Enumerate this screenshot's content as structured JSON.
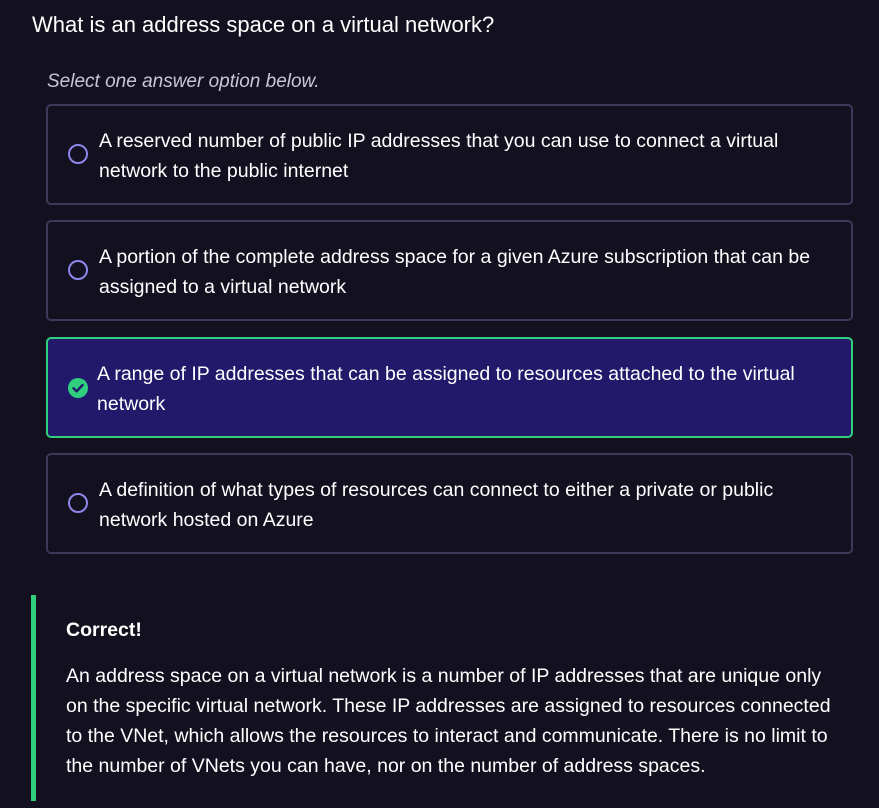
{
  "question": "What is an address space on a virtual network?",
  "instruction": "Select one answer option below.",
  "options": [
    {
      "text": "A reserved number of public IP addresses that you can use to connect a virtual network to the public internet",
      "selected": false
    },
    {
      "text": "A portion of the complete address space for a given Azure subscription that can be assigned to a virtual network",
      "selected": false
    },
    {
      "text": "A range of IP addresses that can be assigned to resources attached to the virtual network",
      "selected": true
    },
    {
      "text": "A definition of what types of resources can connect to either a private or public network hosted on Azure",
      "selected": false
    }
  ],
  "feedback": {
    "title": "Correct!",
    "body": "An address space on a virtual network is a number of IP addresses that are unique only on the specific virtual network. These IP addresses are assigned to resources connected to the VNet, which allows the resources to interact and communicate. There is no limit to the number of VNets you can have, nor on the number of address spaces."
  },
  "colors": {
    "background": "#13111f",
    "option_border": "#3b3a5a",
    "selected_background": "#23196b",
    "correct_accent": "#2fcf7e",
    "radio_outline": "#8f86ea"
  },
  "icons": {
    "unselected": "radio-circle-icon",
    "selected": "check-circle-icon"
  }
}
